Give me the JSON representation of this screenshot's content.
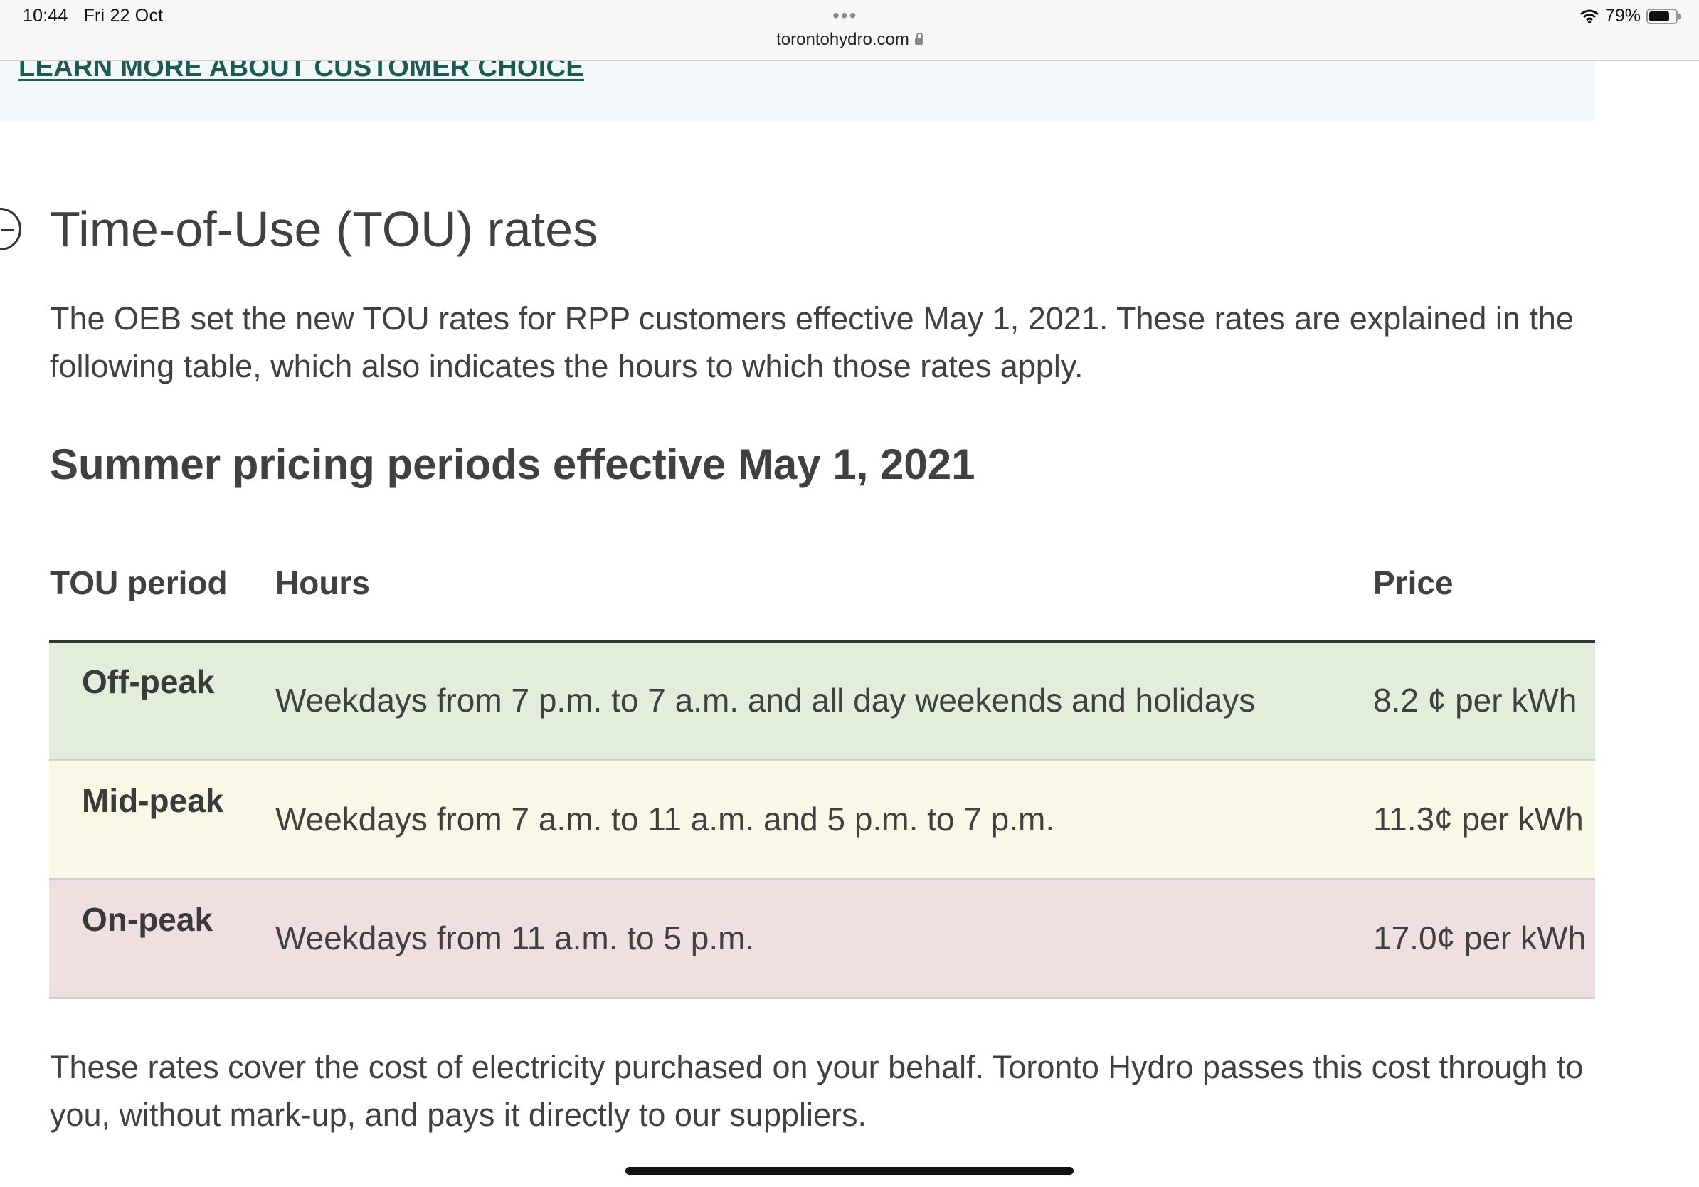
{
  "status_bar": {
    "time": "10:44",
    "date": "Fri 22 Oct",
    "url": "torontohydro.com",
    "battery": "79%",
    "battery_level": 0.79
  },
  "banner": {
    "link_label": "LEARN MORE ABOUT CUSTOMER CHOICE"
  },
  "section": {
    "title": "Time-of-Use (TOU) rates",
    "intro": "The OEB set the new TOU rates for RPP customers effective May 1, 2021. These rates are explained in the following table, which also indicates the hours to which those rates apply.",
    "subtitle": "Summer pricing periods effective May 1, 2021"
  },
  "table": {
    "headers": {
      "period": "TOU period",
      "hours": "Hours",
      "price": "Price"
    },
    "rows": [
      {
        "period": "Off-peak",
        "hours": "Weekdays from 7 p.m. to 7 a.m. and all day weekends and holidays",
        "price": "8.2 ¢ per kWh",
        "color": "#e2eedb"
      },
      {
        "period": "Mid-peak",
        "hours": "Weekdays from 7 a.m. to 11 a.m. and 5 p.m. to 7 p.m.",
        "price": "11.3¢ per kWh",
        "color": "#f9f7e6"
      },
      {
        "period": "On-peak",
        "hours": "Weekdays from 11 a.m. to 5 p.m.",
        "price": "17.0¢ per kWh",
        "color": "#efdfe0"
      }
    ]
  },
  "footnote": "These rates cover the cost of electricity purchased on your behalf. Toronto Hydro passes this cost through to you, without mark-up, and pays it directly to our suppliers."
}
